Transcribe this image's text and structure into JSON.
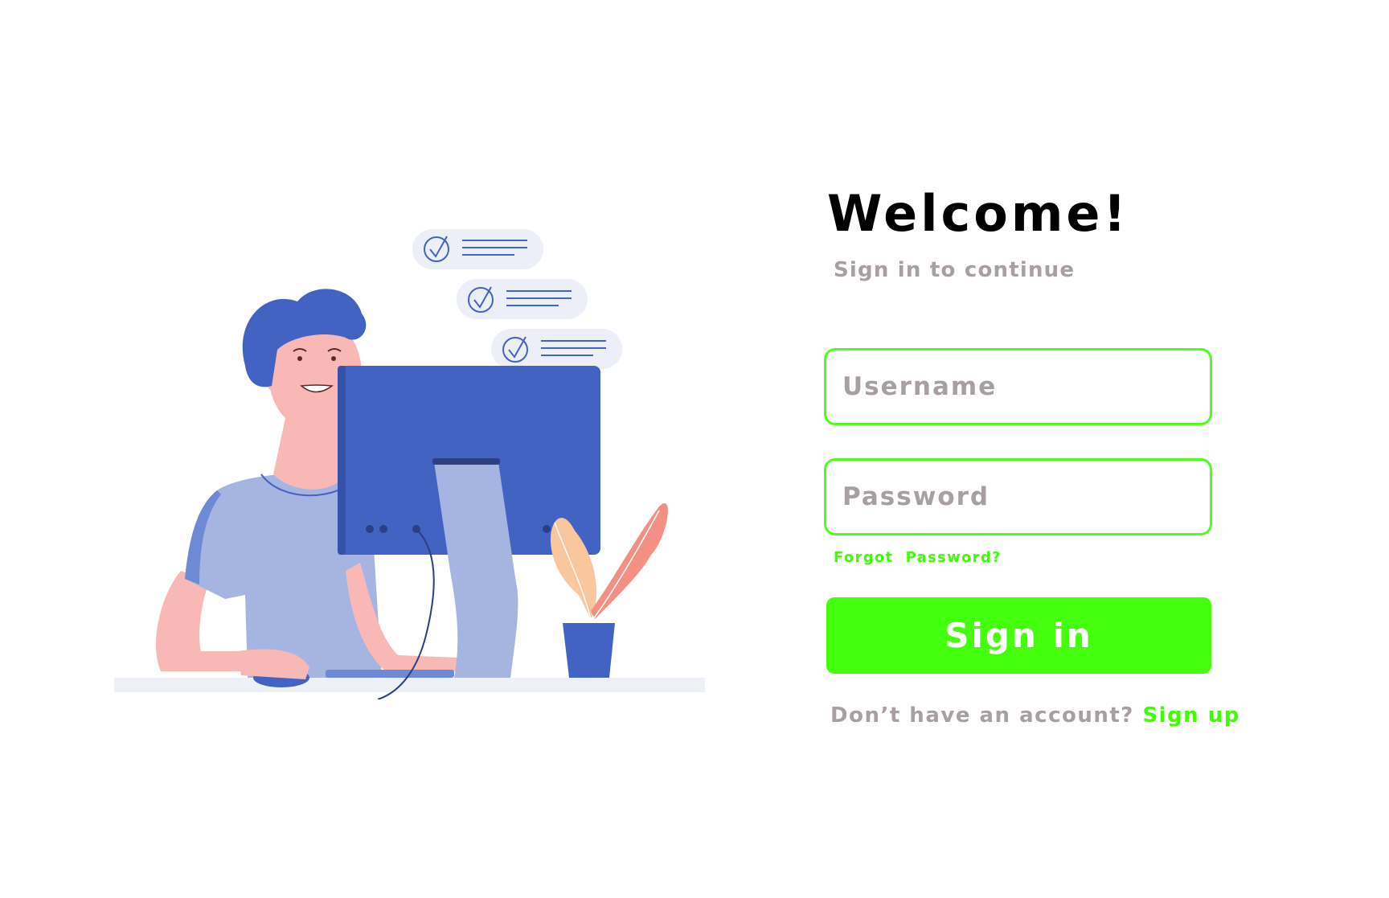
{
  "login": {
    "title": "Welcome!",
    "subtitle": "Sign in to continue",
    "username_placeholder": "Username",
    "password_placeholder": "Password",
    "forgot_password": "Forgot  Password?",
    "signin_label": "Sign in",
    "signup_prompt": "Don’t have an account?",
    "signup_link": "Sign up"
  },
  "colors": {
    "accent": "#43ff0b",
    "muted_text": "#a8a0a0",
    "illustration_blue": "#4263c2",
    "illustration_lavender": "#a5b4e0",
    "skin": "#f7b8b6"
  },
  "illustration": {
    "icons": [
      "person-at-computer",
      "checklist-bubble-icon",
      "plant-icon",
      "monitor-icon"
    ]
  }
}
